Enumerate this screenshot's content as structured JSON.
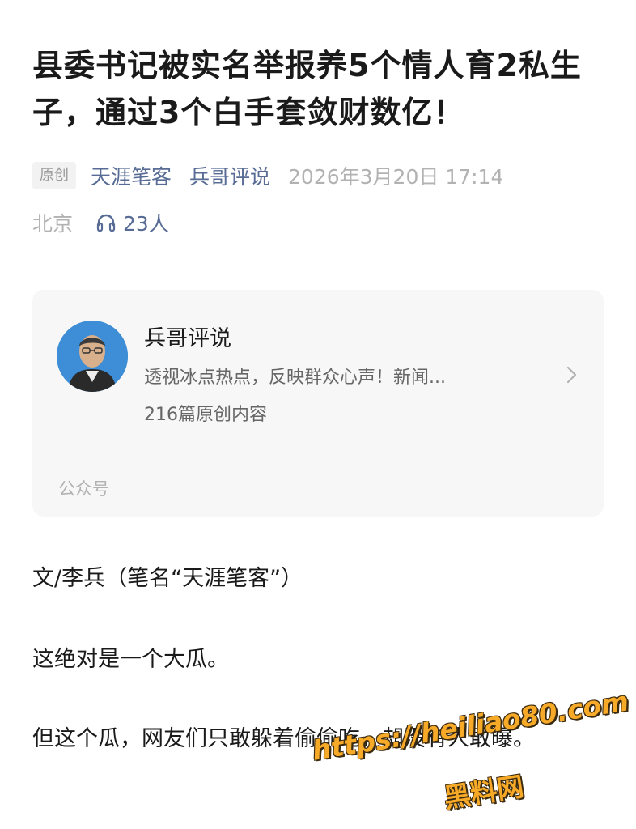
{
  "article": {
    "title": "县委书记被实名举报养5个情人育2私生子，通过3个白手套敛财数亿！",
    "original_badge": "原创",
    "author": "天涯笔客",
    "account": "兵哥评说",
    "datetime": "2026年3月20日 17:14",
    "location": "北京",
    "listen_count": "23人"
  },
  "profile_card": {
    "name": "兵哥评说",
    "description": "透视冰点热点，反映群众心声！新闻...",
    "post_count": "216篇原创内容",
    "footer_label": "公众号",
    "avatar_bg": "#3d8ed6"
  },
  "body": {
    "paragraphs": [
      "文/李兵（笔名“天涯笔客”）",
      "这绝对是一个大瓜。",
      "但这个瓜，网友们只敢躲着偷偷吃，却没有人敢曝。"
    ]
  },
  "watermark": {
    "url": "https://heiliao80.com",
    "name": "黑料网"
  },
  "colors": {
    "link": "#576b95",
    "muted": "#b2b2b2",
    "card_bg": "#f7f7f7",
    "watermark": "#f7a928"
  },
  "icons": {
    "listen": "headphones-icon",
    "card_arrow": "chevron-right-icon"
  }
}
